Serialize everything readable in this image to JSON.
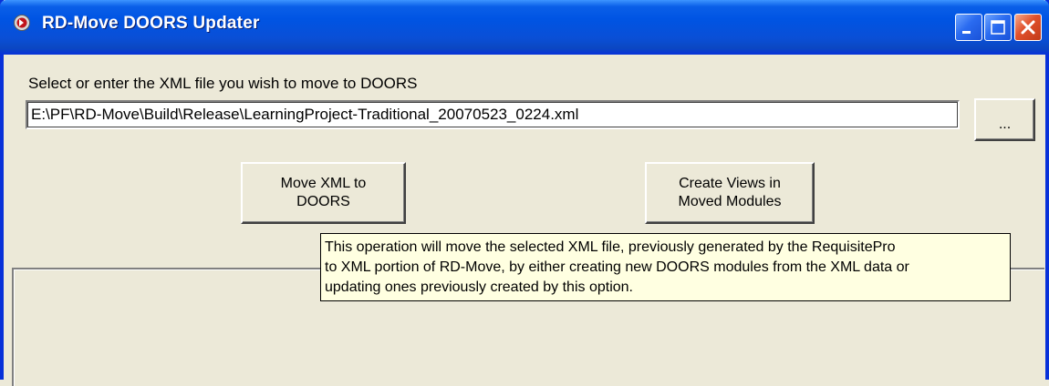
{
  "window": {
    "title": "RD-Move DOORS Updater",
    "icon": "rd-move-app-icon",
    "controls": [
      "minimize-icon",
      "maximize-icon",
      "close-icon"
    ]
  },
  "form": {
    "select_label": "Select or enter the XML file you wish to move to DOORS",
    "file_path_value": "E:\\PF\\RD-Move\\Build\\Release\\LearningProject-Traditional_20070523_0224.xml",
    "browse_label": "...",
    "move_button_label": "Move XML to\nDOORS",
    "views_button_label": "Create Views in\nMoved Modules"
  },
  "tooltip": {
    "lines": [
      "This operation will move the selected XML file, previously generated by the RequisitePro",
      "to XML portion of RD-Move, by either creating new DOORS modules from the XML data or",
      "updating ones previously created by this option."
    ]
  },
  "colors": {
    "titlebar": "#0054e3",
    "window_bg": "#ece9d8",
    "tooltip_bg": "#ffffe1",
    "close_button": "#e0502b"
  }
}
